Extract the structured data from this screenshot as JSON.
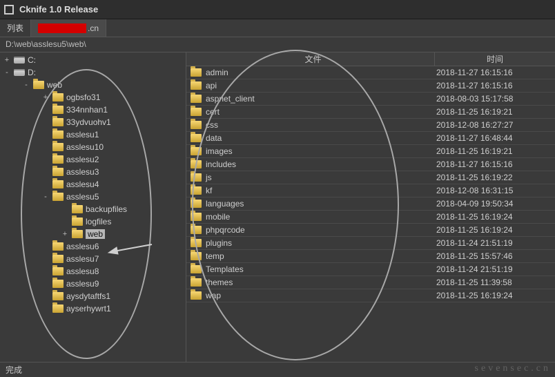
{
  "window": {
    "title": "Cknife 1.0 Release"
  },
  "tabs": {
    "list_label": "列表",
    "host_suffix": ".cn"
  },
  "path": "D:\\web\\asslesu5\\web\\",
  "tree": [
    {
      "exp": "+",
      "icon": "drive",
      "label": "C:",
      "indent": 0
    },
    {
      "exp": "-",
      "icon": "drive",
      "label": "D:",
      "indent": 0
    },
    {
      "exp": "-",
      "icon": "folder",
      "label": "web",
      "indent": 1
    },
    {
      "exp": "+",
      "icon": "folder",
      "label": "ogbsfo31",
      "indent": 2
    },
    {
      "exp": "",
      "icon": "folder",
      "label": "334nnhan1",
      "indent": 2
    },
    {
      "exp": "",
      "icon": "folder",
      "label": "33ydvuohv1",
      "indent": 2
    },
    {
      "exp": "",
      "icon": "folder",
      "label": "asslesu1",
      "indent": 2
    },
    {
      "exp": "",
      "icon": "folder",
      "label": "asslesu10",
      "indent": 2
    },
    {
      "exp": "",
      "icon": "folder",
      "label": "asslesu2",
      "indent": 2
    },
    {
      "exp": "",
      "icon": "folder",
      "label": "asslesu3",
      "indent": 2
    },
    {
      "exp": "",
      "icon": "folder",
      "label": "asslesu4",
      "indent": 2
    },
    {
      "exp": "-",
      "icon": "folder",
      "label": "asslesu5",
      "indent": 2
    },
    {
      "exp": "",
      "icon": "folder",
      "label": "backupfiles",
      "indent": 3
    },
    {
      "exp": "",
      "icon": "folder",
      "label": "logfiles",
      "indent": 3
    },
    {
      "exp": "+",
      "icon": "folder",
      "label": "web",
      "indent": 3,
      "selected": true
    },
    {
      "exp": "",
      "icon": "folder",
      "label": "asslesu6",
      "indent": 2
    },
    {
      "exp": "",
      "icon": "folder",
      "label": "asslesu7",
      "indent": 2
    },
    {
      "exp": "",
      "icon": "folder",
      "label": "asslesu8",
      "indent": 2
    },
    {
      "exp": "",
      "icon": "folder",
      "label": "asslesu9",
      "indent": 2
    },
    {
      "exp": "",
      "icon": "folder",
      "label": "aysdytaftfs1",
      "indent": 2
    },
    {
      "exp": "",
      "icon": "folder",
      "label": "ayserhywrt1",
      "indent": 2
    }
  ],
  "columns": {
    "file": "文件",
    "time": "时间"
  },
  "files": [
    {
      "name": "admin",
      "time": "2018-11-27 16:15:16"
    },
    {
      "name": "api",
      "time": "2018-11-27 16:15:16"
    },
    {
      "name": "aspnet_client",
      "time": "2018-08-03 15:17:58"
    },
    {
      "name": "cert",
      "time": "2018-11-25 16:19:21"
    },
    {
      "name": "css",
      "time": "2018-12-08 16:27:27"
    },
    {
      "name": "data",
      "time": "2018-11-27 16:48:44"
    },
    {
      "name": "images",
      "time": "2018-11-25 16:19:21"
    },
    {
      "name": "includes",
      "time": "2018-11-27 16:15:16"
    },
    {
      "name": "js",
      "time": "2018-11-25 16:19:22"
    },
    {
      "name": "kf",
      "time": "2018-12-08 16:31:15"
    },
    {
      "name": "languages",
      "time": "2018-04-09 19:50:34"
    },
    {
      "name": "mobile",
      "time": "2018-11-25 16:19:24"
    },
    {
      "name": "phpqrcode",
      "time": "2018-11-25 16:19:24"
    },
    {
      "name": "plugins",
      "time": "2018-11-24 21:51:19"
    },
    {
      "name": "temp",
      "time": "2018-11-25 15:57:46"
    },
    {
      "name": "Templates",
      "time": "2018-11-24 21:51:19"
    },
    {
      "name": "themes",
      "time": "2018-11-25 11:39:58"
    },
    {
      "name": "wap",
      "time": "2018-11-25 16:19:24"
    }
  ],
  "status": "完成",
  "watermark": "sevensec.cn"
}
